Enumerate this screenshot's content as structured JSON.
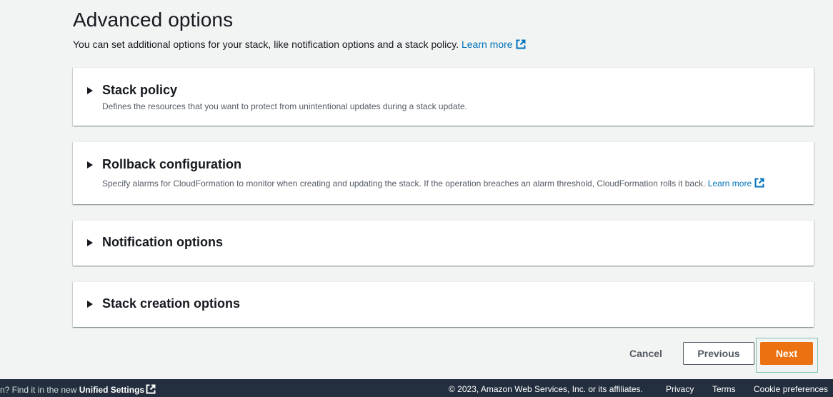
{
  "header": {
    "title": "Advanced options",
    "description": "You can set additional options for your stack, like notification options and a stack policy.",
    "learn_more": "Learn more"
  },
  "panels": [
    {
      "title": "Stack policy",
      "description": "Defines the resources that you want to protect from unintentional updates during a stack update."
    },
    {
      "title": "Rollback configuration",
      "description": "Specify alarms for CloudFormation to monitor when creating and updating the stack. If the operation breaches an alarm threshold, CloudFormation rolls it back.",
      "learn_more": "Learn more"
    },
    {
      "title": "Notification options"
    },
    {
      "title": "Stack creation options"
    }
  ],
  "actions": {
    "cancel": "Cancel",
    "previous": "Previous",
    "next": "Next"
  },
  "footer": {
    "left_text": "n? Find it in the new",
    "left_link": "Unified Settings",
    "copyright": "© 2023, Amazon Web Services, Inc. or its affiliates.",
    "privacy": "Privacy",
    "terms": "Terms",
    "cookie_preferences": "Cookie preferences"
  },
  "colors": {
    "background": "#f2f3f3",
    "link": "#0073bb",
    "primary_button": "#ec7211",
    "footer": "#232f3e"
  },
  "icons": {
    "external_link": "external-link-icon",
    "panel_caret": "caret-right-icon"
  }
}
